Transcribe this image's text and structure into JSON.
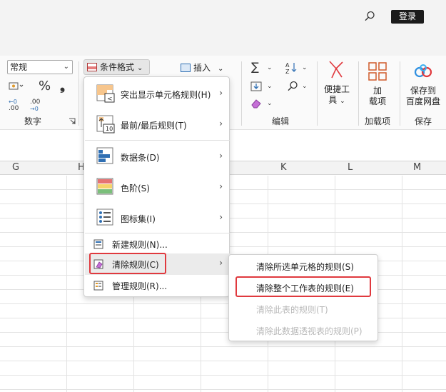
{
  "titlebar": {
    "login_label": "登录"
  },
  "ribbon": {
    "number_format_value": "常规",
    "percent_symbol": "%",
    "comma_symbol": "❟",
    "dec_increase": ".00",
    "dec_decrease": ".0",
    "group_number": "数字",
    "conditional_format_label": "条件格式",
    "insert_label": "插入",
    "group_edit": "编辑",
    "quick_tools_label_1": "便捷工",
    "quick_tools_label_2": "具",
    "addins_label_1": "加",
    "addins_label_2": "载项",
    "group_addins": "加载项",
    "save_label_1": "保存到",
    "save_label_2": "百度网盘",
    "group_save": "保存"
  },
  "columns": [
    "G",
    "H",
    "K",
    "L",
    "M"
  ],
  "menu": {
    "items": [
      {
        "label": "突出显示单元格规则(H)",
        "key": "H"
      },
      {
        "label": "最前/最后规则(T)",
        "key": "T"
      },
      {
        "label": "数据条(D)",
        "key": "D"
      },
      {
        "label": "色阶(S)",
        "key": "S"
      },
      {
        "label": "图标集(I)",
        "key": "I"
      },
      {
        "label": "新建规则(N)...",
        "key": "N"
      },
      {
        "label": "清除规则(C)",
        "key": "C"
      },
      {
        "label": "管理规则(R)...",
        "key": "R"
      }
    ],
    "topbottom_icon_number": "10"
  },
  "submenu": {
    "items": [
      {
        "label": "清除所选单元格的规则(S)"
      },
      {
        "label": "清除整个工作表的规则(E)"
      },
      {
        "label": "清除此表的规则(T)"
      },
      {
        "label": "清除此数据透视表的规则(P)"
      }
    ]
  },
  "colors": {
    "highlight_red": "#e0393e",
    "accent_blue": "#2f6fb3"
  }
}
